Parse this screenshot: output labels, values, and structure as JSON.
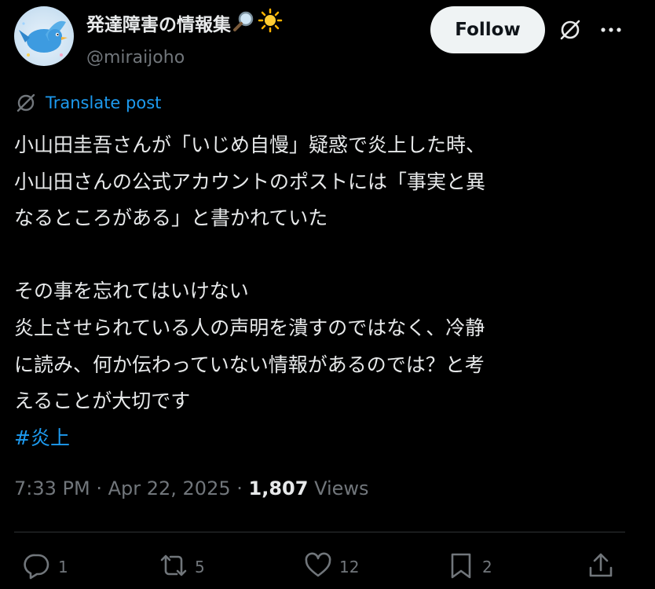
{
  "author": {
    "display_name": "発達障害の情報集",
    "handle": "@miraijoho",
    "follow_label": "Follow"
  },
  "translate_label": "Translate post",
  "tweet": {
    "lines": [
      "小山田圭吾さんが「いじめ自慢」疑惑で炎上した時、",
      "小山田さんの公式アカウントのポストには「事実と異",
      "なるところがある」と書かれていた",
      "",
      "その事を忘れてはいけない",
      "炎上させられている人の声明を潰すのではなく、冷静",
      "に読み、何か伝わっていない情報があるのでは？と考",
      "えることが大切です"
    ],
    "hashtag": "#炎上"
  },
  "meta": {
    "time": "7:33 PM",
    "separator": " · ",
    "date": "Apr 22, 2025",
    "views_count": "1,807",
    "views_label": "Views"
  },
  "actions": {
    "replies": "1",
    "reposts": "5",
    "likes": "12",
    "bookmarks": "2"
  },
  "colors": {
    "background": "#000000",
    "text": "#e7e9ea",
    "muted": "#71767b",
    "accent": "#1d9bf0",
    "divider": "#2f3336"
  },
  "icons": [
    "bird-avatar",
    "magnifier-emoji",
    "sun-emoji",
    "grok-icon",
    "more-icon",
    "translate-icon",
    "reply-icon",
    "repost-icon",
    "like-icon",
    "bookmark-icon",
    "share-icon"
  ]
}
